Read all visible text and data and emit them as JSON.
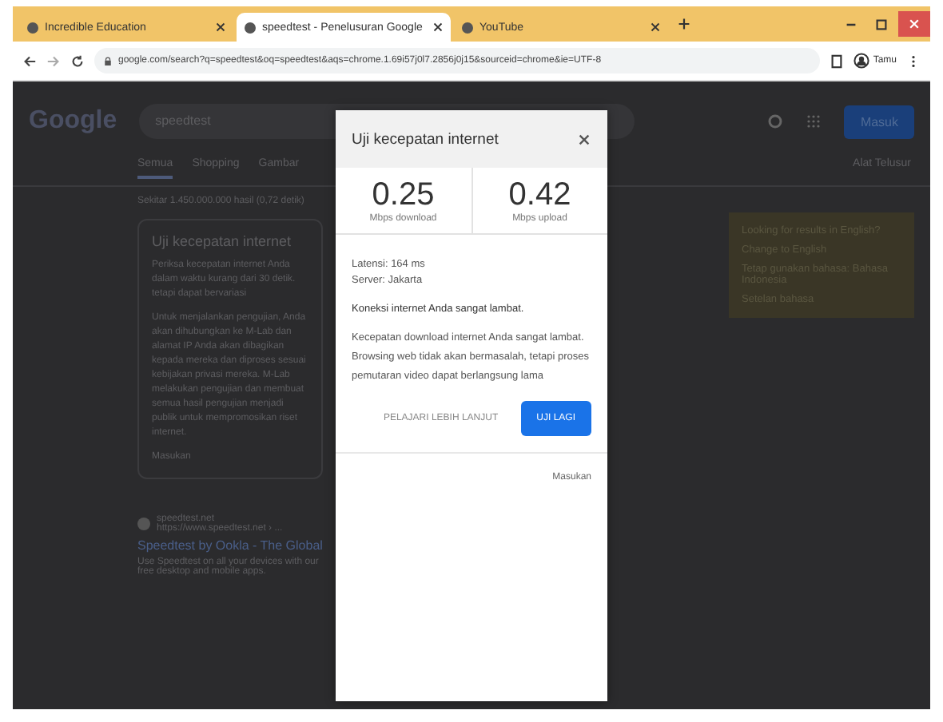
{
  "browser": {
    "tabs": [
      {
        "title": "Incredible Education",
        "selected": false
      },
      {
        "title": "speedtest - Penelusuran Google",
        "selected": true
      },
      {
        "title": "YouTube",
        "selected": false
      }
    ],
    "url": "google.com/search?q=speedtest&oq=speedtest&aqs=chrome.1.69i57j0l7.2856j0j15&sourceid=chrome&ie=UTF-8",
    "profile": "Tamu"
  },
  "search_page": {
    "logo": "Google",
    "query": "speedtest",
    "sign_in": "Masuk",
    "tabs": [
      {
        "label": "Semua",
        "selected": true
      },
      {
        "label": "Shopping",
        "selected": false
      },
      {
        "label": "Gambar",
        "selected": false
      }
    ],
    "tools": "Alat Telusur",
    "result_stats": "Sekitar 1.450.000.000 hasil (0,72 detik)",
    "card": {
      "title": "Uji kecepatan internet",
      "paragraphs": [
        "Periksa kecepatan internet Anda dalam waktu kurang dari 30 detik. tetapi dapat bervariasi",
        "Untuk menjalankan pengujian, Anda akan dihubungkan ke M-Lab dan alamat IP Anda akan dibagikan kepada mereka dan diproses sesuai kebijakan privasi mereka. M-Lab melakukan pengujian dan membuat semua hasil pengujian menjadi publik untuk mempromosikan riset internet."
      ],
      "footer": "Masukan"
    },
    "language_box": {
      "title": "Looking for results in English?",
      "links": [
        "Change to English",
        "Tetap gunakan bahasa: Bahasa Indonesia",
        "Setelan bahasa"
      ]
    },
    "result": {
      "site": "speedtest.net",
      "url": "https://www.speedtest.net › ...",
      "title": "Speedtest by Ookla - The Global",
      "snippet": "Use Speedtest on all your devices with our free desktop and mobile apps."
    }
  },
  "dialog": {
    "title": "Uji kecepatan internet",
    "metrics": [
      {
        "value": "0.25",
        "label": "Mbps download"
      },
      {
        "value": "0.42",
        "label": "Mbps upload"
      }
    ],
    "details": [
      "Latensi: 164 ms",
      "Server: Jakarta"
    ],
    "verdict": "Koneksi internet Anda sangat lambat.",
    "description": "Kecepatan download internet Anda sangat lambat. Browsing web tidak akan bermasalah, tetapi proses pemutaran video dapat berlangsung lama",
    "learn_more": "PELAJARI LEBIH LANJUT",
    "retry": "UJI LAGI",
    "feedback": "Masukan"
  }
}
